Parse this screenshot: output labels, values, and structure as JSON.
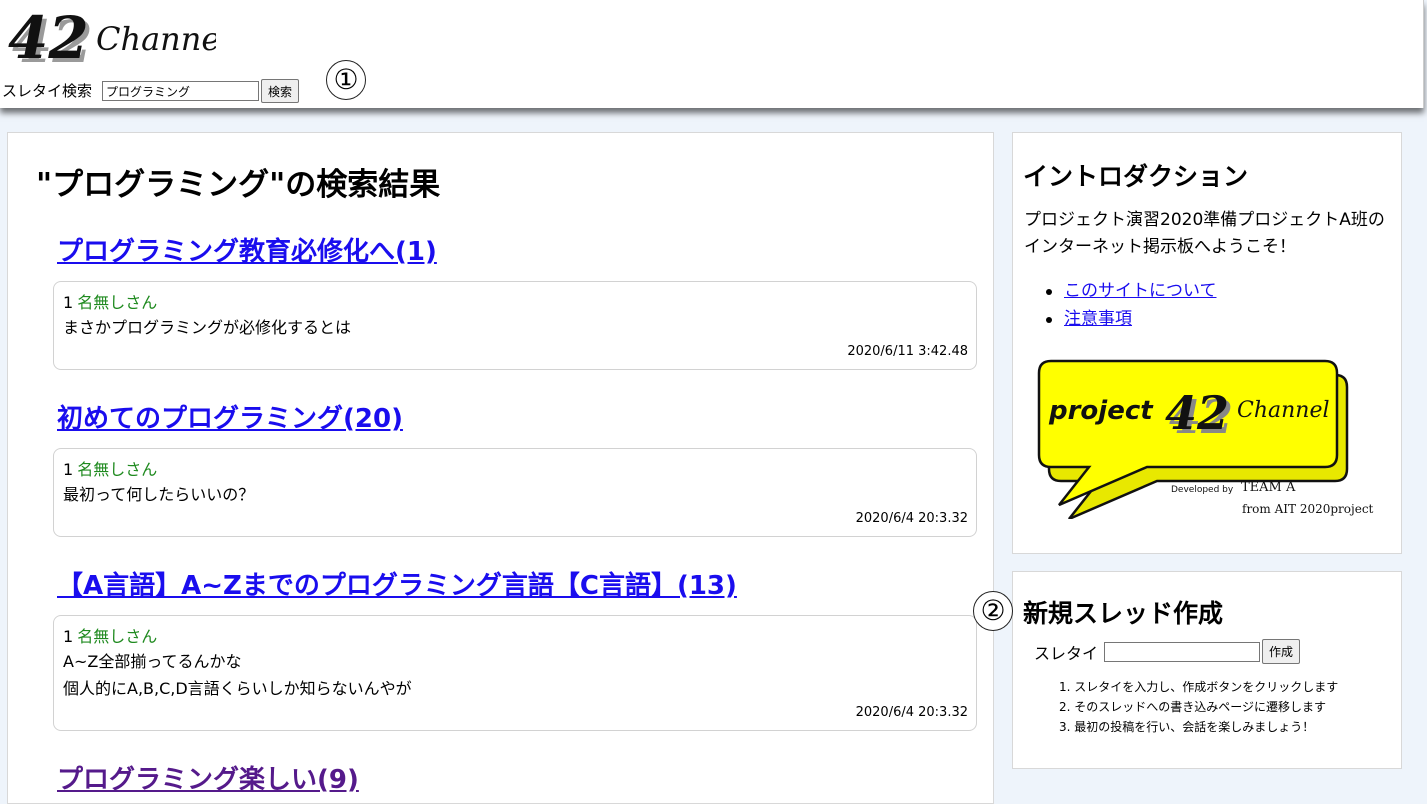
{
  "header": {
    "logo_number": "42",
    "logo_text": "Channel",
    "search_label": "スレタイ検索",
    "search_value": "プログラミング",
    "search_button": "検索",
    "callout_1": "①"
  },
  "main": {
    "results_title": "\"プログラミング\"の検索結果",
    "threads": [
      {
        "title": "プログラミング教育必修化へ(1)",
        "post": {
          "number": "1",
          "name": "名無しさん",
          "lines": [
            "まさかプログラミングが必修化するとは"
          ],
          "date": "2020/6/11 3:42.48"
        }
      },
      {
        "title": "初めてのプログラミング(20)",
        "post": {
          "number": "1",
          "name": "名無しさん",
          "lines": [
            "最初って何したらいいの？"
          ],
          "date": "2020/6/4 20:3.32"
        }
      },
      {
        "title": "【A言語】A~Zまでのプログラミング言語【C言語】(13)",
        "post": {
          "number": "1",
          "name": "名無しさん",
          "lines": [
            "A~Z全部揃ってるんかな",
            "個人的にA,B,C,D言語くらいしか知らないんやが"
          ],
          "date": "2020/6/4 20:3.32"
        }
      },
      {
        "title": "プログラミング楽しい(9)"
      }
    ]
  },
  "sidebar": {
    "intro": {
      "title": "イントロダクション",
      "text": "プロジェクト演習2020準備プロジェクトA班のインターネット掲示板へようこそ！",
      "links": [
        "このサイトについて",
        "注意事項"
      ],
      "promo_word": "project",
      "promo_number": "42",
      "promo_channel": "Channel",
      "promo_developed": "Developed by",
      "promo_team": "TEAM A",
      "promo_from": "from AIT 2020project"
    },
    "new_thread": {
      "callout_2": "②",
      "title": "新規スレッド作成",
      "label": "スレタイ",
      "input_value": "",
      "button": "作成",
      "steps": [
        "1. スレタイを入力し、作成ボタンをクリックします",
        "2. そのスレッドへの書き込みページに遷移します",
        "3. 最初の投稿を行い、会話を楽しみましょう！"
      ]
    }
  }
}
